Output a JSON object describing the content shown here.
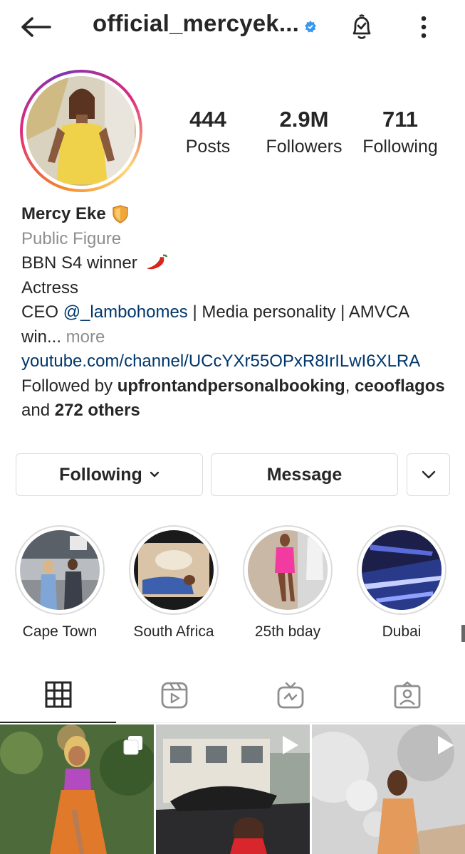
{
  "header": {
    "username": "official_mercyek...",
    "back_icon": "arrow-left-icon",
    "bell_icon": "bell-check-icon",
    "more_icon": "more-vertical-icon"
  },
  "profile": {
    "stats": [
      {
        "value": "444",
        "label": "Posts"
      },
      {
        "value": "2.9M",
        "label": "Followers"
      },
      {
        "value": "711",
        "label": "Following"
      }
    ],
    "name": "Mercy Eke",
    "category": "Public Figure",
    "bio_line1": "BBN S4 winner",
    "bio_line2": "Actress",
    "bio_line3_prefix": "CEO ",
    "bio_mention": "@_lambohomes",
    "bio_line3_suffix": " | Media personality | AMVCA",
    "bio_line4": "win...",
    "bio_more": " more",
    "website": "youtube.com/channel/UCcYXr55OPxR8IrILwI6XLRA",
    "followed_by_prefix": "Followed by ",
    "followed_by_user1": "upfrontandpersonalbooking",
    "followed_by_sep": ", ",
    "followed_by_user2": "ceooflagos",
    "followed_by_and": "and ",
    "followed_by_others": "272 others"
  },
  "actions": {
    "following_label": "Following",
    "message_label": "Message"
  },
  "highlights": [
    {
      "label": "Cape Town"
    },
    {
      "label": "South Africa"
    },
    {
      "label": "25th bday"
    },
    {
      "label": "Dubai"
    }
  ],
  "tabs": [
    {
      "icon": "grid-icon"
    },
    {
      "icon": "reels-icon"
    },
    {
      "icon": "igtv-icon"
    },
    {
      "icon": "tagged-icon"
    }
  ],
  "colors": {
    "text": "#262626",
    "secondary": "#8e8e8e",
    "link": "#00376b",
    "border": "#dbdbdb",
    "verified": "#3897f0"
  }
}
